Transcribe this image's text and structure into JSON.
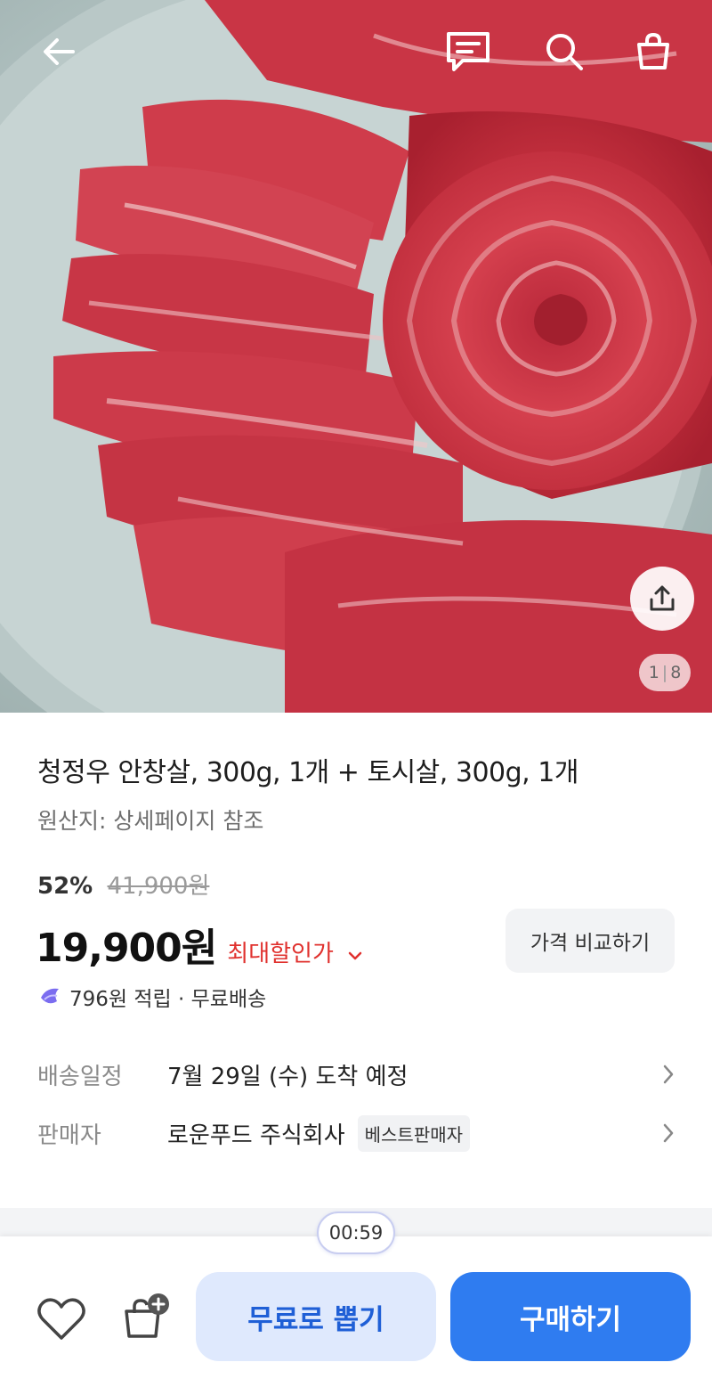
{
  "header": {
    "back_icon": "arrow-left-icon",
    "chat_icon": "chat-bubble-icon",
    "search_icon": "search-icon",
    "cart_icon": "shopping-bag-icon"
  },
  "gallery": {
    "current": "1",
    "total": "8",
    "separator": "|",
    "share_icon": "share-icon"
  },
  "product": {
    "title": "청정우 안창살, 300g, 1개 + 토시살, 300g, 1개",
    "origin": "원산지: 상세페이지 참조",
    "discount_rate": "52%",
    "original_price": "41,900원",
    "price": "19,900원",
    "max_discount_label": "최대할인가",
    "compare_label": "가격 비교하기",
    "reward_text": "796원 적립 · 무료배송"
  },
  "info": {
    "shipping_label": "배송일정",
    "shipping_value": "7월 29일 (수) 도착 예정",
    "seller_label": "판매자",
    "seller_value": "로운푸드 주식회사",
    "seller_badge": "베스트판매자"
  },
  "bottom": {
    "timer": "00:59",
    "draw_label": "무료로 뽑기",
    "buy_label": "구매하기"
  },
  "colors": {
    "accent_blue": "#2f7cf0",
    "draw_bg": "#dfe9fd",
    "discount_red": "#e0312e"
  }
}
